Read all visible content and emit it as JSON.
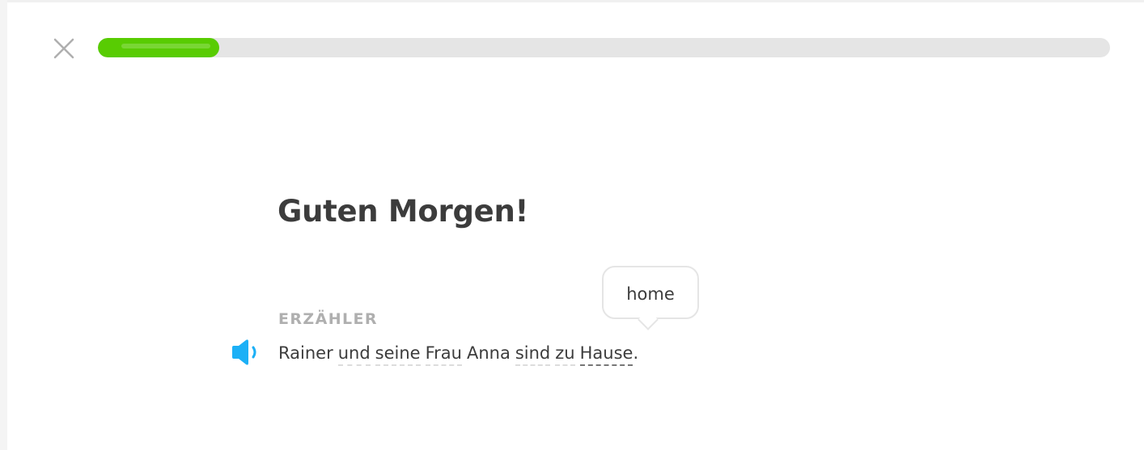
{
  "header": {
    "close_icon": "close-icon",
    "progress_fraction": 0.12,
    "progress_color": "#58cc02"
  },
  "story": {
    "title": "Guten Morgen!",
    "speaker": "ERZÄHLER",
    "audio_icon": "speaker-icon",
    "audio_color": "#1cb0f6",
    "sentence": [
      {
        "text": "Rainer",
        "hint": false
      },
      {
        "text": "und",
        "hint": true
      },
      {
        "text": "seine",
        "hint": true
      },
      {
        "text": "Frau",
        "hint": true
      },
      {
        "text": "Anna",
        "hint": false
      },
      {
        "text": "sind",
        "hint": true
      },
      {
        "text": "zu",
        "hint": true
      },
      {
        "text": "Hause",
        "hint": true,
        "active": true
      }
    ],
    "punctuation": ".",
    "tooltip": "home"
  }
}
